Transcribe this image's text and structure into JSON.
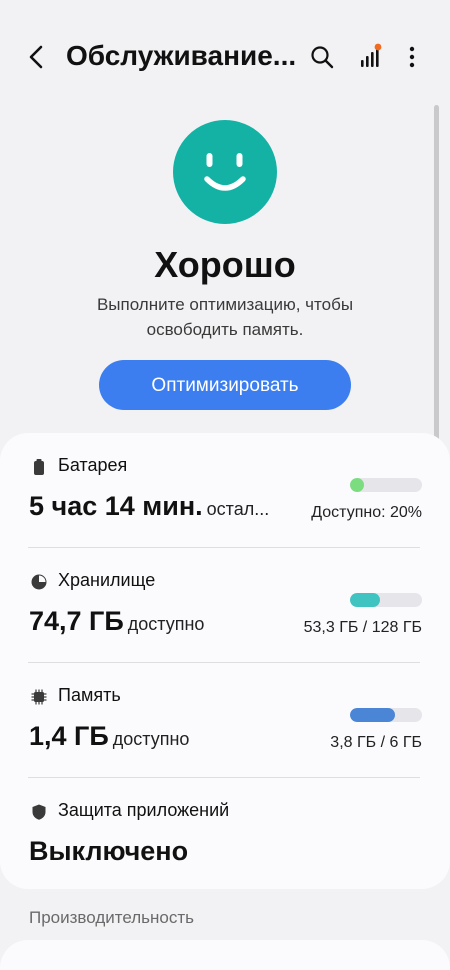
{
  "header": {
    "title": "Обслуживание...",
    "icons": {
      "back": "back-chevron-icon",
      "search": "search-icon",
      "diagnostics": "signal-bars-icon",
      "more": "more-vertical-icon"
    },
    "notification_dot_color": "#f26b21"
  },
  "status": {
    "face_icon": "smiley-face-icon",
    "face_color": "#13b2a5",
    "title": "Хорошо",
    "subtitle_line1": "Выполните оптимизацию, чтобы",
    "subtitle_line2": "освободить память.",
    "optimize_button": "Оптимизировать",
    "accent_color": "#3c7ef0"
  },
  "items": {
    "battery": {
      "icon": "battery-icon",
      "label": "Батарея",
      "value": "5 час 14 мин.",
      "value_suffix": "остал...",
      "detail": "Доступно: 20%",
      "level": 0.2,
      "bar_color": "#7cdc80"
    },
    "storage": {
      "icon": "pie-chart-icon",
      "label": "Хранилище",
      "value": "74,7 ГБ",
      "value_suffix": "доступно",
      "detail": "53,3 ГБ / 128 ГБ",
      "level": 0.42,
      "bar_color": "#3fc4c2"
    },
    "memory": {
      "icon": "memory-chip-icon",
      "label": "Память",
      "value": "1,4 ГБ",
      "value_suffix": "доступно",
      "detail": "3,8 ГБ / 6 ГБ",
      "level": 0.63,
      "bar_color": "#4b86d6"
    },
    "app_protection": {
      "icon": "shield-icon",
      "label": "Защита приложений",
      "value": "Выключено"
    }
  },
  "sections": {
    "performance": "Производительность"
  }
}
